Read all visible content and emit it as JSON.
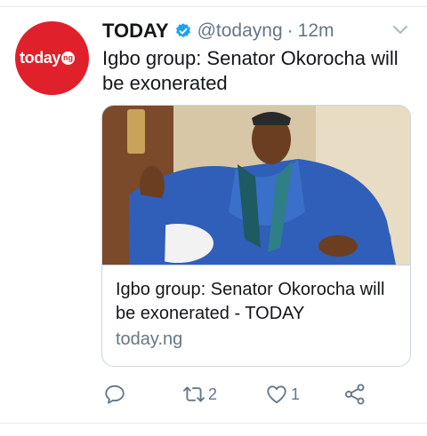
{
  "tweet": {
    "author_name": "TODAY",
    "handle": "@todayng",
    "separator": "·",
    "time": "12m",
    "text": "Igbo group: Senator Okorocha will be exonerated",
    "avatar": {
      "brand_text": "today",
      "badge_text": "ng",
      "color": "#e0202b"
    },
    "verified_icon": "verified-badge-icon",
    "verified_color": "#1da1f2"
  },
  "card": {
    "title": "Igbo group: Senator Okorocha will be exonerated - TODAY",
    "domain": "today.ng"
  },
  "actions": {
    "reply": {
      "icon": "reply-icon",
      "count": ""
    },
    "retweet": {
      "icon": "retweet-icon",
      "count": "2"
    },
    "like": {
      "icon": "heart-icon",
      "count": "1"
    },
    "share": {
      "icon": "share-icon",
      "count": ""
    }
  },
  "colors": {
    "text_primary": "#14171a",
    "text_secondary": "#657786",
    "border": "#ccd6dd"
  }
}
